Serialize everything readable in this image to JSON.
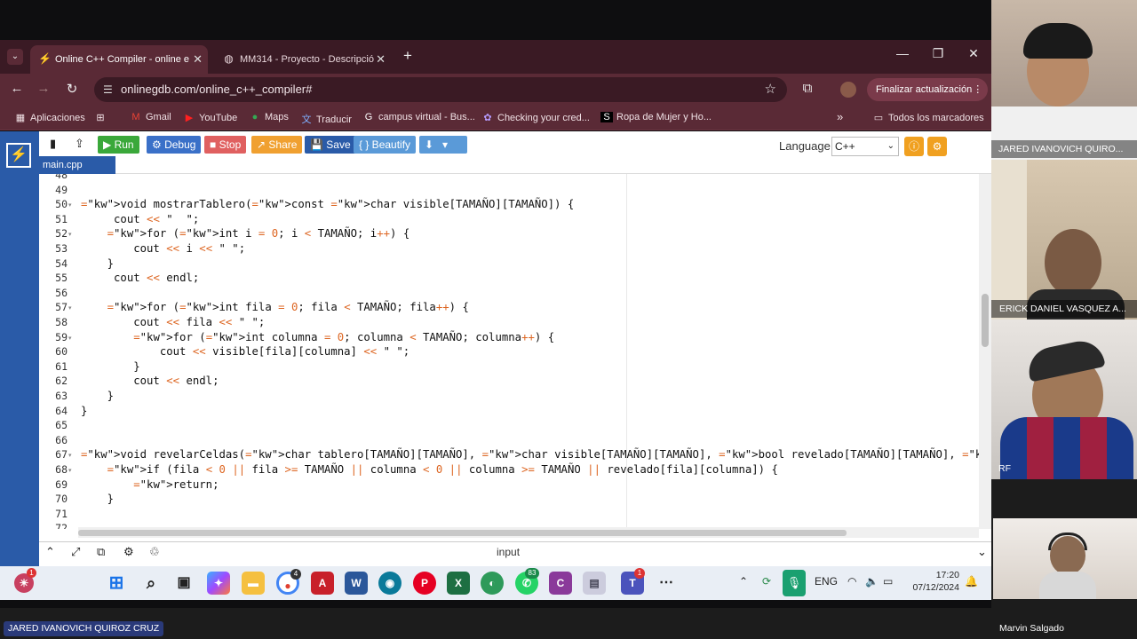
{
  "browser": {
    "tabs": [
      {
        "label": "Online C++ Compiler - online e",
        "active": true
      },
      {
        "label": "MM314 - Proyecto - Descripció",
        "active": false
      }
    ],
    "url": "onlinegdb.com/online_c++_compiler#",
    "update_label": "Finalizar actualización",
    "bookmarks": [
      "Aplicaciones",
      "Gmail",
      "YouTube",
      "Maps",
      "Traducir",
      "campus virtual - Bus...",
      "Checking your cred...",
      "Ropa de Mujer y Ho..."
    ],
    "all_bookmarks_label": "Todos los marcadores"
  },
  "ide": {
    "toolbar": {
      "run": "Run",
      "debug": "Debug",
      "stop": "Stop",
      "share": "Share",
      "save": "Save",
      "beautify": "{ } Beautify"
    },
    "language_label": "Language",
    "language_value": "C++",
    "file_tab": "main.cpp",
    "io_label": "input",
    "code_lines": [
      {
        "n": "48",
        "t": ""
      },
      {
        "n": "49",
        "t": ""
      },
      {
        "n": "50",
        "t": "void mostrarTablero(const char visible[TAMAÑO][TAMAÑO]) {"
      },
      {
        "n": "51",
        "t": "     cout << \"  \";"
      },
      {
        "n": "52",
        "t": "    for (int i = 0; i < TAMAÑO; i++) {"
      },
      {
        "n": "53",
        "t": "        cout << i << \" \";"
      },
      {
        "n": "54",
        "t": "    }"
      },
      {
        "n": "55",
        "t": "     cout << endl;"
      },
      {
        "n": "56",
        "t": ""
      },
      {
        "n": "57",
        "t": "    for (int fila = 0; fila < TAMAÑO; fila++) {"
      },
      {
        "n": "58",
        "t": "        cout << fila << \" \";"
      },
      {
        "n": "59",
        "t": "        for (int columna = 0; columna < TAMAÑO; columna++) {"
      },
      {
        "n": "60",
        "t": "            cout << visible[fila][columna] << \" \";"
      },
      {
        "n": "61",
        "t": "        }"
      },
      {
        "n": "62",
        "t": "        cout << endl;"
      },
      {
        "n": "63",
        "t": "    }"
      },
      {
        "n": "64",
        "t": "}"
      },
      {
        "n": "65",
        "t": ""
      },
      {
        "n": "66",
        "t": ""
      },
      {
        "n": "67",
        "t": "void revelarCeldas(char tablero[TAMAÑO][TAMAÑO], char visible[TAMAÑO][TAMAÑO], bool revelado[TAMAÑO][TAMAÑO], int fila, int columna) {"
      },
      {
        "n": "68",
        "t": "    if (fila < 0 || fila >= TAMAÑO || columna < 0 || columna >= TAMAÑO || revelado[fila][columna]) {"
      },
      {
        "n": "69",
        "t": "        return;"
      },
      {
        "n": "70",
        "t": "    }"
      },
      {
        "n": "71",
        "t": ""
      },
      {
        "n": "72",
        "t": ""
      }
    ]
  },
  "taskbar": {
    "lang": "ENG",
    "time": "17:20",
    "date": "07/12/2024",
    "badges": {
      "chrome": "4",
      "whatsapp": "83",
      "teams": "1",
      "widgets": "1"
    }
  },
  "meeting": {
    "participants": [
      {
        "name": "JARED IVANOVICH QUIRO..."
      },
      {
        "name": "ERICK DANIEL VASQUEZ A..."
      },
      {
        "name": "RF"
      },
      {
        "name": "Marvin Salgado"
      }
    ],
    "presenter": "JARED IVANOVICH QUIROZ CRUZ"
  }
}
